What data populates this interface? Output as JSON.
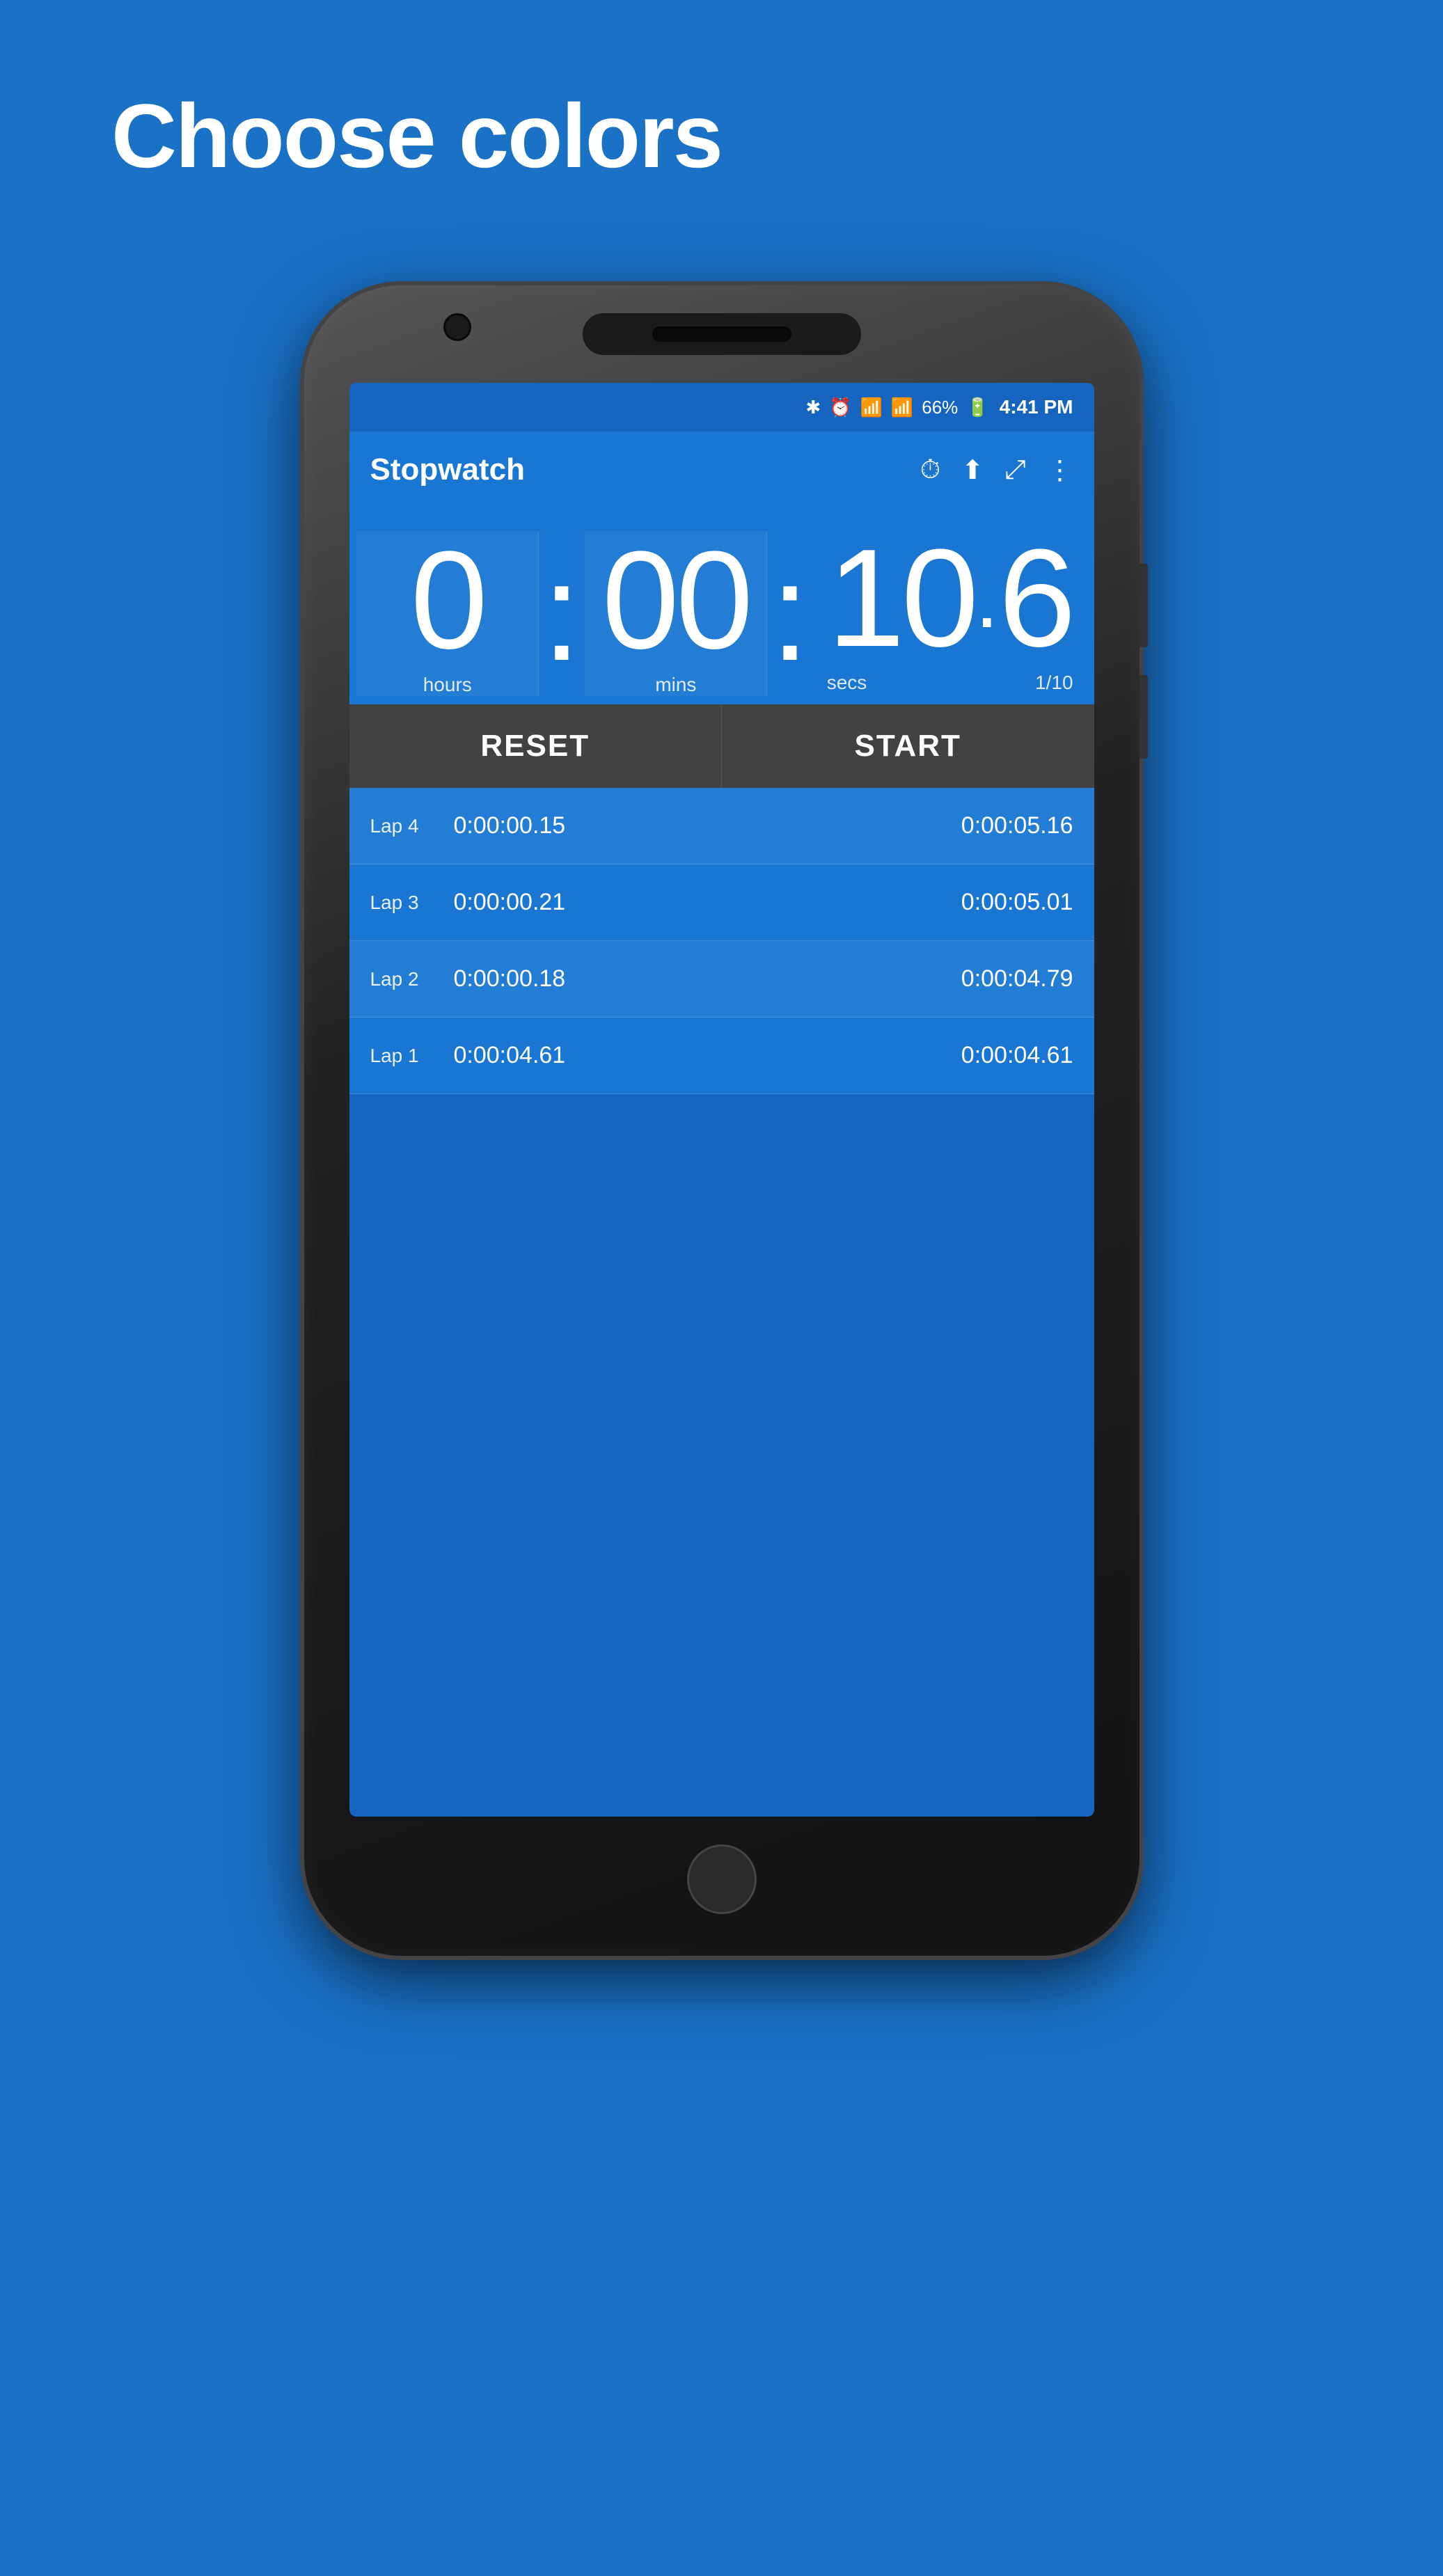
{
  "page": {
    "title": "Choose colors",
    "background_color": "#1a72c7"
  },
  "phone": {
    "status_bar": {
      "battery": "66%",
      "time": "4:41 PM",
      "icons": [
        "⚡",
        "⏰",
        "WiFi",
        "Signal"
      ]
    },
    "app_bar": {
      "title": "Stopwatch",
      "icon_timer": "⏱",
      "icon_share": "⬆",
      "icon_expand": "⤢",
      "icon_more": "⋮"
    },
    "timer": {
      "hours": "0",
      "minutes": "00",
      "seconds": "10",
      "fraction": "6",
      "label_hours": "hours",
      "label_mins": "mins",
      "label_secs": "secs",
      "label_fraction": "1/10"
    },
    "buttons": {
      "reset": "RESET",
      "start": "START"
    },
    "laps": [
      {
        "name": "Lap 4",
        "lap_time": "0:00:00.15",
        "total_time": "0:00:05.16"
      },
      {
        "name": "Lap 3",
        "lap_time": "0:00:00.21",
        "total_time": "0:00:05.01"
      },
      {
        "name": "Lap 2",
        "lap_time": "0:00:00.18",
        "total_time": "0:00:04.79"
      },
      {
        "name": "Lap 1",
        "lap_time": "0:00:04.61",
        "total_time": "0:00:04.61"
      }
    ]
  }
}
